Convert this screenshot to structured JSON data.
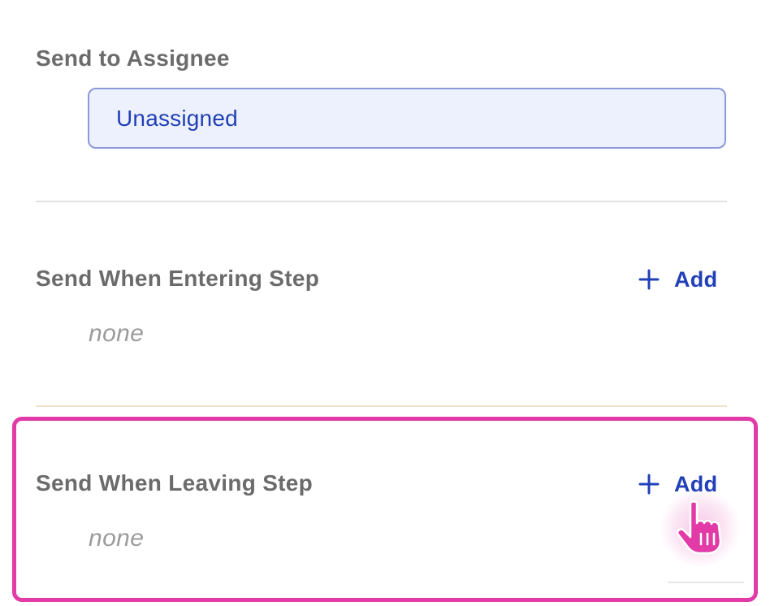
{
  "assignee": {
    "title": "Send to Assignee",
    "value": "Unassigned"
  },
  "entering": {
    "title": "Send When Entering Step",
    "add_label": "Add",
    "empty_text": "none"
  },
  "leaving": {
    "title": "Send When Leaving Step",
    "add_label": "Add",
    "empty_text": "none"
  },
  "icons": {
    "add": "plus-icon",
    "cursor": "hand-pointer-icon"
  },
  "colors": {
    "accent": "#2140b8",
    "highlight": "#e23aa6",
    "title_text": "#6b6b6b",
    "muted_text": "#9b9b9b",
    "select_bg": "#edf1fd",
    "select_border": "#8a98d8"
  }
}
